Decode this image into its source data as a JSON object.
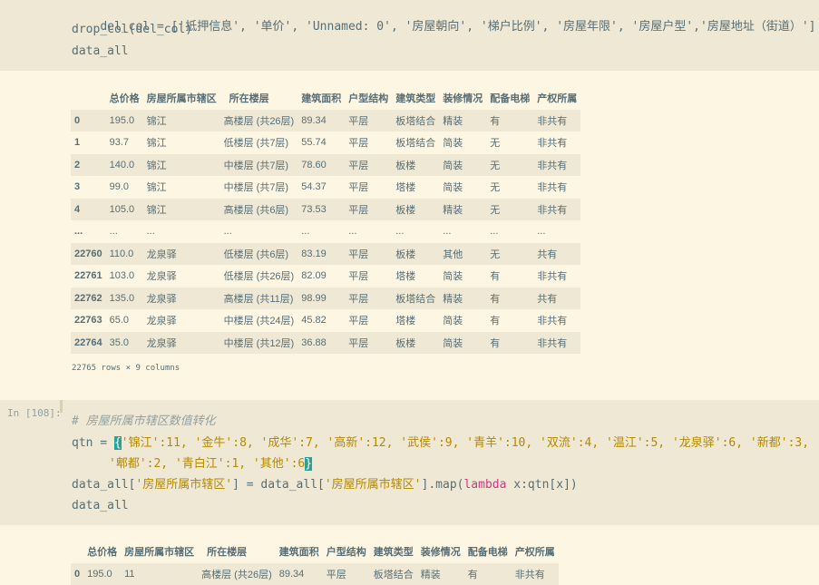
{
  "cell_top": {
    "lines": [
      "del_col = ['抵押信息', '单价', 'Unnamed: 0', '房屋朝向', '梯户比例', '房屋年限', '房屋户型','房屋地址（街道）']",
      "drop_col(del_col)",
      "data_all"
    ]
  },
  "table1": {
    "columns": [
      "",
      "总价格",
      "房屋所属市辖区",
      "所在楼层",
      "建筑面积",
      "户型结构",
      "建筑类型",
      "装修情况",
      "配备电梯",
      "产权所属"
    ],
    "rows": [
      [
        "0",
        "195.0",
        "锦江",
        "高楼层 (共26层)",
        "89.34",
        "平层",
        "板塔结合",
        "精装",
        "有",
        "非共有"
      ],
      [
        "1",
        "93.7",
        "锦江",
        "低楼层 (共7层)",
        "55.74",
        "平层",
        "板塔结合",
        "简装",
        "无",
        "非共有"
      ],
      [
        "2",
        "140.0",
        "锦江",
        "中楼层 (共7层)",
        "78.60",
        "平层",
        "板楼",
        "简装",
        "无",
        "非共有"
      ],
      [
        "3",
        "99.0",
        "锦江",
        "中楼层 (共7层)",
        "54.37",
        "平层",
        "塔楼",
        "简装",
        "无",
        "非共有"
      ],
      [
        "4",
        "105.0",
        "锦江",
        "高楼层 (共6层)",
        "73.53",
        "平层",
        "板楼",
        "精装",
        "无",
        "非共有"
      ],
      [
        "...",
        "...",
        "...",
        "...",
        "...",
        "...",
        "...",
        "...",
        "...",
        "..."
      ],
      [
        "22760",
        "110.0",
        "龙泉驿",
        "低楼层 (共6层)",
        "83.19",
        "平层",
        "板楼",
        "其他",
        "无",
        "共有"
      ],
      [
        "22761",
        "103.0",
        "龙泉驿",
        "低楼层 (共26层)",
        "82.09",
        "平层",
        "塔楼",
        "简装",
        "有",
        "非共有"
      ],
      [
        "22762",
        "135.0",
        "龙泉驿",
        "高楼层 (共11层)",
        "98.99",
        "平层",
        "板塔结合",
        "精装",
        "有",
        "共有"
      ],
      [
        "22763",
        "65.0",
        "龙泉驿",
        "中楼层 (共24层)",
        "45.82",
        "平层",
        "塔楼",
        "简装",
        "有",
        "非共有"
      ],
      [
        "22764",
        "35.0",
        "龙泉驿",
        "中楼层 (共12层)",
        "36.88",
        "平层",
        "板楼",
        "简装",
        "有",
        "非共有"
      ]
    ],
    "footer": "22765 rows × 9 columns"
  },
  "cell2": {
    "prompt": "In [108]:",
    "comment": "# 房屋所属市辖区数值转化",
    "qtn_prefix": "qtn = ",
    "qtn_line1": "'锦江':11, '金牛':8, '成华':7, '高新':12, '武侯':9, '青羊':10, '双流':4, '温江':5, '龙泉驿':6, '新都':3,",
    "qtn_line2": "'郫都':2, '青白江':1, '其他':6",
    "map_line_a": "data_all[",
    "map_str1": "'房屋所属市辖区'",
    "map_line_b": "] = data_all[",
    "map_str2": "'房屋所属市辖区'",
    "map_line_c": "].map(",
    "map_kw": "lambda",
    "map_line_d": " x:qtn[x])",
    "last_line": "data_all"
  },
  "table2": {
    "columns": [
      "",
      "总价格",
      "房屋所属市辖区",
      "所在楼层",
      "建筑面积",
      "户型结构",
      "建筑类型",
      "装修情况",
      "配备电梯",
      "产权所属"
    ],
    "rows": [
      [
        "0",
        "195.0",
        "11",
        "高楼层 (共26层)",
        "89.34",
        "平层",
        "板塔结合",
        "精装",
        "有",
        "非共有"
      ]
    ]
  }
}
